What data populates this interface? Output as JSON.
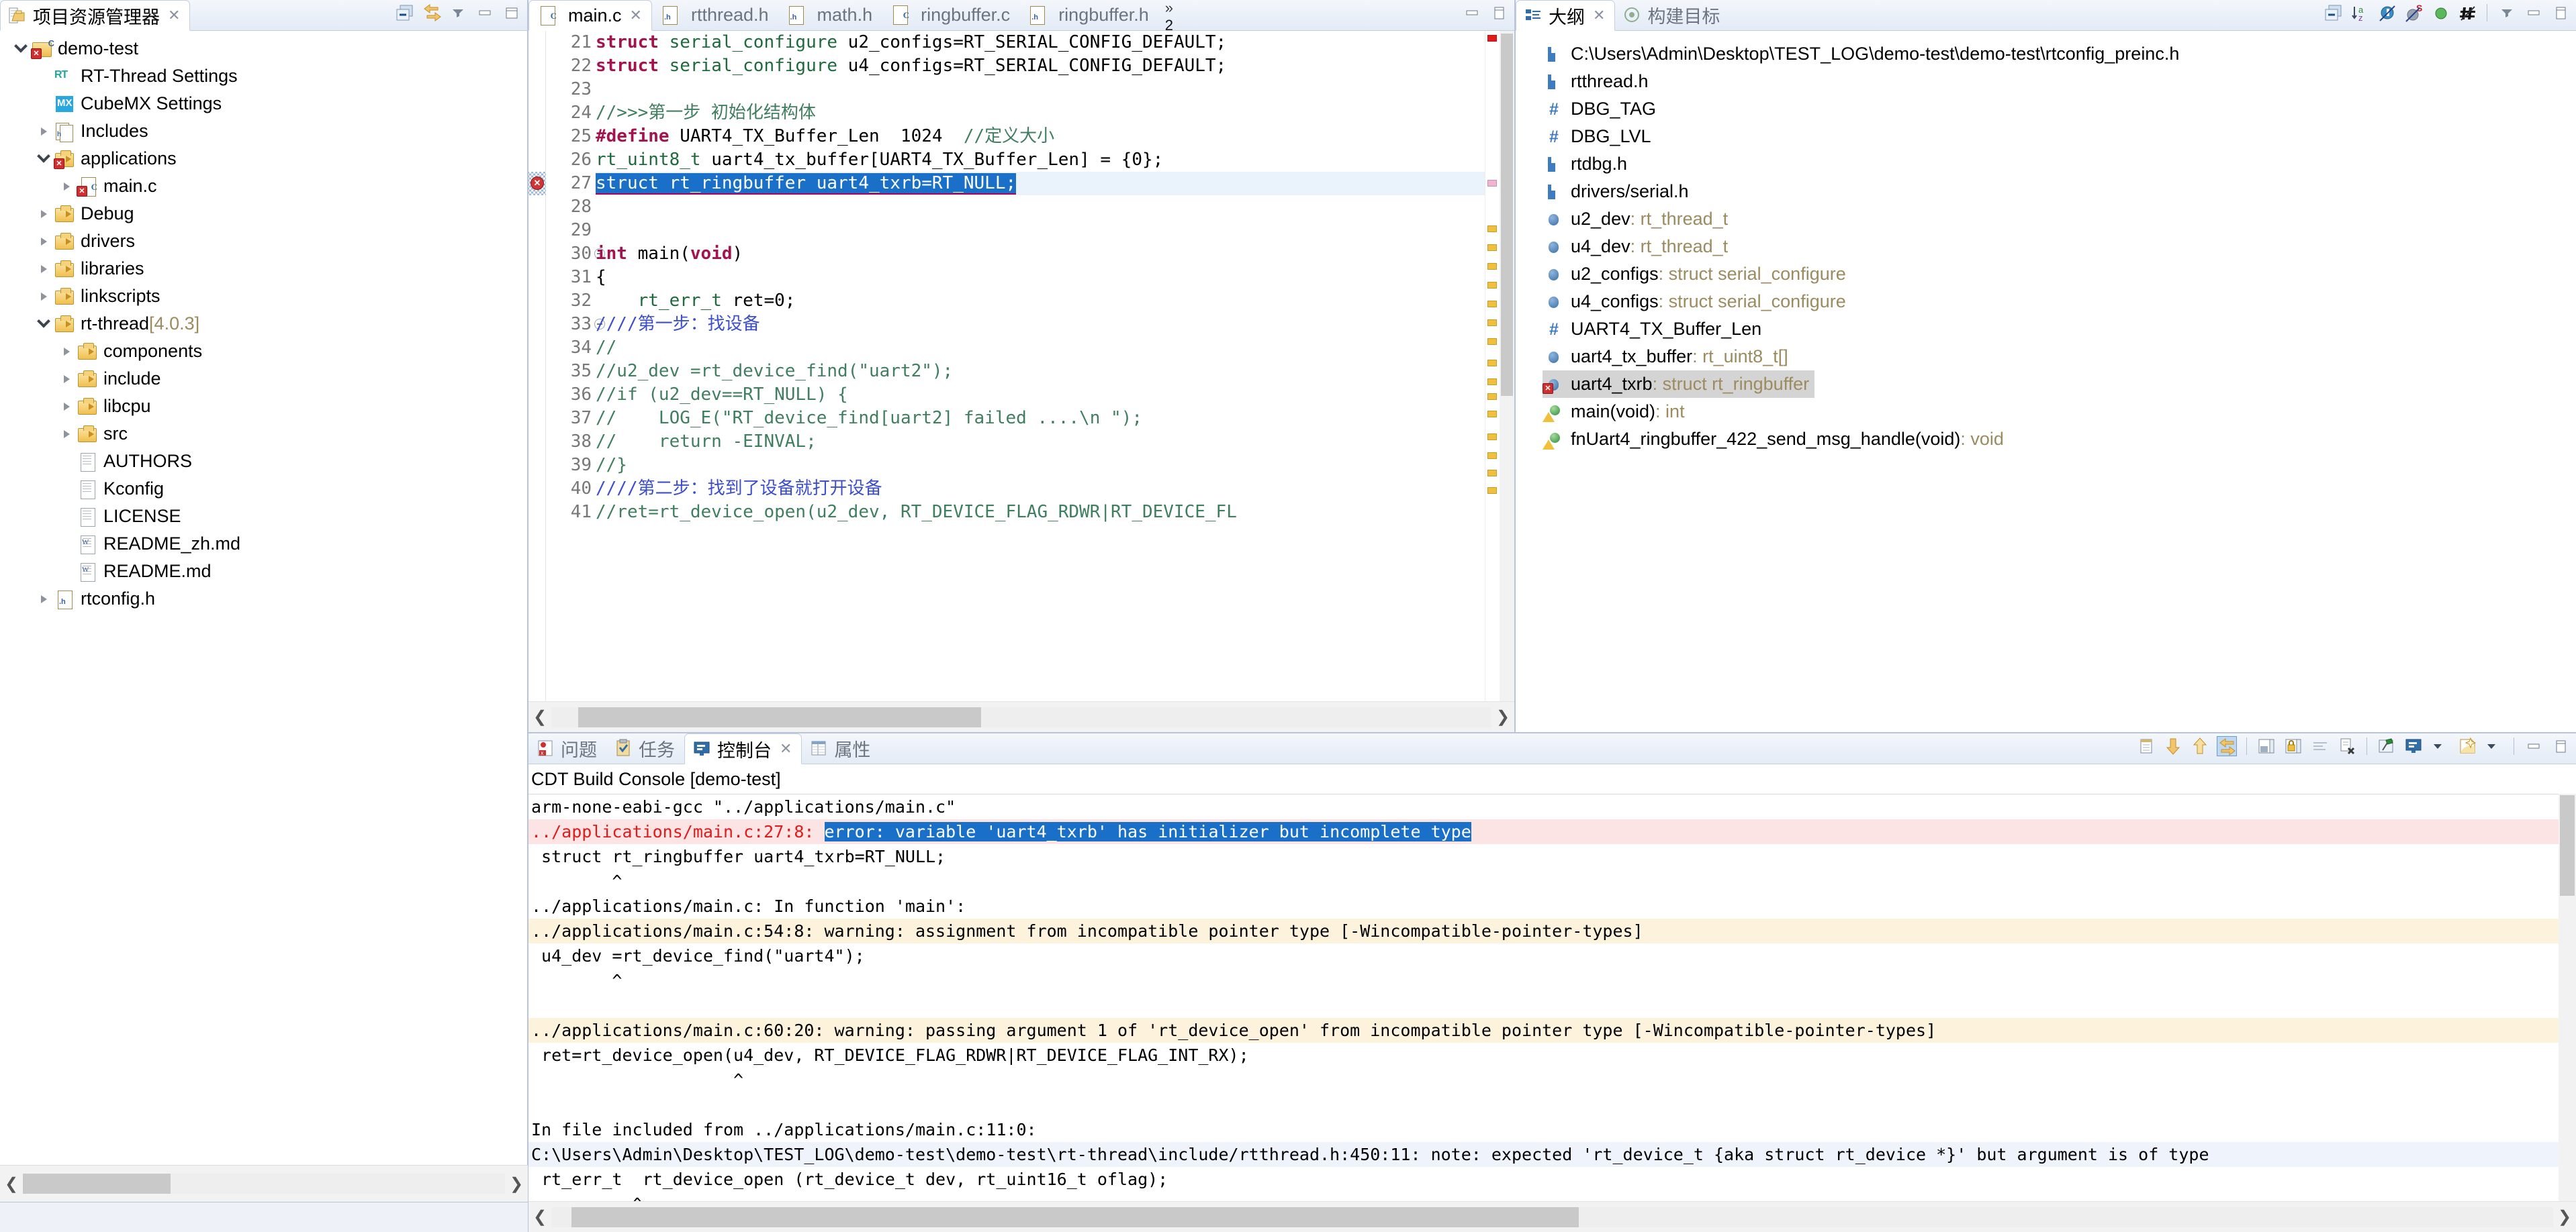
{
  "explorer": {
    "title": "项目资源管理器",
    "close_label": "✕",
    "toolbar": [
      "collapse-all-icon",
      "link-with-editor-icon",
      "view-menu-icon",
      "minimize-icon",
      "maximize-icon"
    ],
    "tree": [
      {
        "depth": 0,
        "label": "demo-test",
        "icon": "c-project-icon",
        "twisty": "open",
        "error": true
      },
      {
        "depth": 1,
        "label": "RT-Thread Settings",
        "icon": "rt-thread-icon",
        "twisty": "none"
      },
      {
        "depth": 1,
        "label": "CubeMX Settings",
        "icon": "cubemx-icon",
        "twisty": "none"
      },
      {
        "depth": 1,
        "label": "Includes",
        "icon": "includes-icon",
        "twisty": "closed"
      },
      {
        "depth": 1,
        "label": "applications",
        "icon": "folder-icon",
        "twisty": "open",
        "error": true
      },
      {
        "depth": 2,
        "label": "main.c",
        "icon": "c-file-icon",
        "twisty": "closed",
        "error": true
      },
      {
        "depth": 1,
        "label": "Debug",
        "icon": "folder-icon",
        "twisty": "closed"
      },
      {
        "depth": 1,
        "label": "drivers",
        "icon": "folder-icon",
        "twisty": "closed"
      },
      {
        "depth": 1,
        "label": "libraries",
        "icon": "folder-icon",
        "twisty": "closed"
      },
      {
        "depth": 1,
        "label": "linkscripts",
        "icon": "folder-icon",
        "twisty": "closed"
      },
      {
        "depth": 1,
        "label": "rt-thread",
        "suffix": "[4.0.3]",
        "icon": "folder-icon",
        "twisty": "open"
      },
      {
        "depth": 2,
        "label": "components",
        "icon": "folder-icon",
        "twisty": "closed"
      },
      {
        "depth": 2,
        "label": "include",
        "icon": "folder-icon",
        "twisty": "closed"
      },
      {
        "depth": 2,
        "label": "libcpu",
        "icon": "folder-icon",
        "twisty": "closed"
      },
      {
        "depth": 2,
        "label": "src",
        "icon": "folder-icon",
        "twisty": "closed"
      },
      {
        "depth": 2,
        "label": "AUTHORS",
        "icon": "text-file-icon",
        "twisty": "none"
      },
      {
        "depth": 2,
        "label": "Kconfig",
        "icon": "text-file-icon",
        "twisty": "none"
      },
      {
        "depth": 2,
        "label": "LICENSE",
        "icon": "text-file-icon",
        "twisty": "none"
      },
      {
        "depth": 2,
        "label": "README_zh.md",
        "icon": "markdown-file-icon",
        "twisty": "none"
      },
      {
        "depth": 2,
        "label": "README.md",
        "icon": "markdown-file-icon",
        "twisty": "none"
      },
      {
        "depth": 1,
        "label": "rtconfig.h",
        "icon": "h-file-icon",
        "twisty": "closed"
      }
    ]
  },
  "editor": {
    "tabs": [
      {
        "label": "main.c",
        "icon": "c-file-icon",
        "active": true,
        "closable": true
      },
      {
        "label": "rtthread.h",
        "icon": "h-file-icon",
        "active": false
      },
      {
        "label": "math.h",
        "icon": "h-file-icon",
        "active": false
      },
      {
        "label": "ringbuffer.c",
        "icon": "c-file-icon",
        "active": false
      },
      {
        "label": "ringbuffer.h",
        "icon": "h-file-icon",
        "active": false
      }
    ],
    "more_tabs_indicator": "»",
    "more_tabs_count": "2",
    "toolbar": [
      "minimize-icon",
      "maximize-icon"
    ],
    "lines": [
      {
        "n": "21",
        "html": "<span class=\"kw\">struct</span> <span class=\"ty\">serial_configure</span> u2_configs=RT_SERIAL_CONFIG_DEFAULT;"
      },
      {
        "n": "22",
        "html": "<span class=\"kw\">struct</span> <span class=\"ty\">serial_configure</span> u4_configs=RT_SERIAL_CONFIG_DEFAULT;"
      },
      {
        "n": "23",
        "html": ""
      },
      {
        "n": "24",
        "html": "<span class=\"cm\">//&gt;&gt;&gt;第一步 初始化结构体</span>"
      },
      {
        "n": "25",
        "html": "<span class=\"pre\">#define</span> UART4_TX_Buffer_Len  1024  <span class=\"cm\">//定义大小</span>"
      },
      {
        "n": "26",
        "html": "<span class=\"ty\">rt_uint8_t</span> uart4_tx_buffer[UART4_TX_Buffer_Len] = {0};"
      },
      {
        "n": "27",
        "html": "struct rt_ringbuffer uart4_txrb=RT_NULL;",
        "selected": true,
        "error": true
      },
      {
        "n": "28",
        "html": ""
      },
      {
        "n": "29",
        "html": ""
      },
      {
        "n": "30",
        "html": "<span class=\"kw\">int</span> main(<span class=\"kw\">void</span>)",
        "fold": true
      },
      {
        "n": "31",
        "html": "{"
      },
      {
        "n": "32",
        "html": "    <span class=\"ty\">rt_err_t</span> ret=0;"
      },
      {
        "n": "33",
        "html": "<span class=\"cmtask\">////第一步：找设备</span>",
        "fold": true
      },
      {
        "n": "34",
        "html": "<span class=\"cm\">//</span>"
      },
      {
        "n": "35",
        "html": "<span class=\"cm\">//u2_dev =rt_device_find(\"uart2\");</span>"
      },
      {
        "n": "36",
        "html": "<span class=\"cm\">//if (u2_dev==RT_NULL) {</span>"
      },
      {
        "n": "37",
        "html": "<span class=\"cm\">//    LOG_E(\"RT_device_find[uart2] failed ....\\n \");</span>"
      },
      {
        "n": "38",
        "html": "<span class=\"cm\">//    return -EINVAL;</span>"
      },
      {
        "n": "39",
        "html": "<span class=\"cm\">//}</span>"
      },
      {
        "n": "40",
        "html": "<span class=\"cmtask\">////第二步：找到了设备就打开设备</span>"
      },
      {
        "n": "41",
        "html": "<span class=\"cm\">//ret=rt_device_open(u2_dev, RT_DEVICE_FLAG_RDWR|RT_DEVICE_FL</span>"
      }
    ]
  },
  "outline": {
    "tabs": [
      {
        "label": "大纲",
        "icon": "outline-icon",
        "active": true,
        "closable": true
      },
      {
        "label": "构建目标",
        "icon": "build-targets-icon",
        "active": false
      }
    ],
    "toolbar": [
      "collapse-all-icon",
      "sort-az-icon",
      "hide-fields-icon",
      "hide-static-icon",
      "hide-nonpublic-icon",
      "hide-macros-icon",
      "view-menu-icon",
      "minimize-icon",
      "maximize-icon"
    ],
    "items": [
      {
        "icon": "include-icon",
        "label": "C:\\Users\\Admin\\Desktop\\TEST_LOG\\demo-test\\demo-test\\rtconfig_preinc.h"
      },
      {
        "icon": "include-icon",
        "label": "rtthread.h"
      },
      {
        "icon": "define-icon",
        "label": "DBG_TAG"
      },
      {
        "icon": "define-icon",
        "label": "DBG_LVL"
      },
      {
        "icon": "include-icon",
        "label": "rtdbg.h"
      },
      {
        "icon": "include-icon",
        "label": "drivers/serial.h"
      },
      {
        "icon": "variable-icon",
        "label": "u2_dev",
        "type": " : rt_thread_t"
      },
      {
        "icon": "variable-icon",
        "label": "u4_dev",
        "type": " : rt_thread_t"
      },
      {
        "icon": "variable-icon",
        "label": "u2_configs",
        "type": " : struct serial_configure"
      },
      {
        "icon": "variable-icon",
        "label": "u4_configs",
        "type": " : struct serial_configure"
      },
      {
        "icon": "define-icon",
        "label": "UART4_TX_Buffer_Len"
      },
      {
        "icon": "variable-icon",
        "label": "uart4_tx_buffer",
        "type": " : rt_uint8_t[]"
      },
      {
        "icon": "variable-icon",
        "label": "uart4_txrb",
        "type": " : struct rt_ringbuffer",
        "selected": true,
        "error": true
      },
      {
        "icon": "function-icon",
        "label": "main(void)",
        "type": " : int",
        "warning": true
      },
      {
        "icon": "function-icon",
        "label": "fnUart4_ringbuffer_422_send_msg_handle(void)",
        "type": " : void",
        "warning": true
      }
    ]
  },
  "console": {
    "tabs": [
      {
        "label": "问题",
        "icon": "problems-icon",
        "active": false
      },
      {
        "label": "任务",
        "icon": "tasks-icon",
        "active": false
      },
      {
        "label": "控制台",
        "icon": "console-icon",
        "active": true,
        "closable": true
      },
      {
        "label": "属性",
        "icon": "properties-icon",
        "active": false
      }
    ],
    "toolbar": [
      "clear-console-icon",
      "scroll-down-icon",
      "scroll-up-icon",
      "scroll-lock-icon",
      "show-console-icon",
      "pin-console-icon",
      "word-wrap-icon",
      "remove-console-icon",
      "pin-icon",
      "display-console-icon",
      "display-console-dropdown-icon",
      "open-console-icon",
      "open-console-dropdown-icon",
      "minimize-icon",
      "maximize-icon"
    ],
    "title": "CDT Build Console [demo-test]",
    "lines": [
      {
        "text": "arm-none-eabi-gcc \"../applications/main.c\"",
        "style": "plain"
      },
      {
        "text": "../applications/main.c:27:8: ",
        "sel": "error: variable 'uart4_txrb' has initializer but incomplete type",
        "style": "err"
      },
      {
        "text": " struct rt_ringbuffer uart4_txrb=RT_NULL;",
        "style": "plain"
      },
      {
        "text": "        ^",
        "style": "plain"
      },
      {
        "text": "../applications/main.c: In function 'main':",
        "style": "plain"
      },
      {
        "text": "../applications/main.c:54:8: warning: assignment from incompatible pointer type [-Wincompatible-pointer-types]",
        "style": "warn"
      },
      {
        "text": " u4_dev =rt_device_find(\"uart4\");",
        "style": "plain"
      },
      {
        "text": "        ^",
        "style": "plain"
      },
      {
        "text": "",
        "style": "plain"
      },
      {
        "text": "../applications/main.c:60:20: warning: passing argument 1 of 'rt_device_open' from incompatible pointer type [-Wincompatible-pointer-types]",
        "style": "warn"
      },
      {
        "text": " ret=rt_device_open(u4_dev, RT_DEVICE_FLAG_RDWR|RT_DEVICE_FLAG_INT_RX);",
        "style": "plain"
      },
      {
        "text": "                    ^",
        "style": "plain"
      },
      {
        "text": "",
        "style": "plain"
      },
      {
        "text": "In file included from ../applications/main.c:11:0:",
        "style": "plain"
      },
      {
        "text": "C:\\Users\\Admin\\Desktop\\TEST_LOG\\demo-test\\demo-test\\rt-thread\\include/rtthread.h:450:11: note: expected 'rt_device_t {aka struct rt_device *}' but argument is of type",
        "style": "note"
      },
      {
        "text": " rt_err_t  rt_device_open (rt_device_t dev, rt_uint16_t oflag);",
        "style": "plain"
      },
      {
        "text": "          ^",
        "style": "plain"
      }
    ]
  },
  "colors": {
    "accent": "#1a70c8",
    "error_bg": "#fce4e4",
    "error_fg": "#e01b1b",
    "warn_bg": "#fdf3dc",
    "note_bg": "#eef3fc",
    "keyword": "#a5134f",
    "type": "#1d6b3c",
    "comment": "#3f7f5f",
    "task_comment": "#3b4ecc",
    "selection": "#1a70c8",
    "chrome": "#e3ebf6"
  }
}
